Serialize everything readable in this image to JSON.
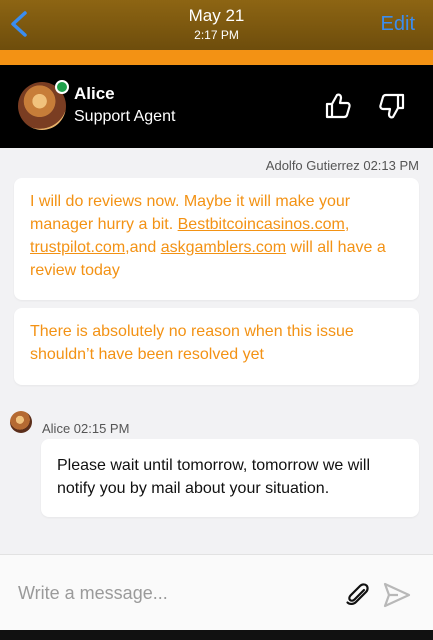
{
  "nav": {
    "date": "May 21",
    "time": "2:17 PM",
    "edit_label": "Edit"
  },
  "agent": {
    "name": "Alice",
    "role": "Support Agent",
    "status": "online"
  },
  "messages": [
    {
      "author": "Adolfo Gutierrez",
      "time": "02:13 PM",
      "meta": "Adolfo Gutierrez 02:13 PM",
      "parts": {
        "t1": "I will do reviews now. Maybe it will make your manager hurry a bit. ",
        "l1": "Bestbitcoincasinos.com",
        "t2": ", ",
        "l2": "trustpilot.com",
        "t3": ",and ",
        "l3": "askgamblers.com",
        "t4": " will all have a review today"
      }
    },
    {
      "author": "Adolfo Gutierrez",
      "text": "There is absolutely no reason when this issue shouldn’t have been resolved yet"
    },
    {
      "author": "Alice",
      "time": "02:15 PM",
      "meta": "Alice 02:15 PM",
      "text": "Please wait until tomorrow, tomorrow we will notify you by mail about your situation."
    }
  ],
  "composer": {
    "placeholder": "Write a message..."
  },
  "icons": {
    "back": "chevron-left-icon",
    "thumbs_up": "thumbs-up-icon",
    "thumbs_down": "thumbs-down-icon",
    "attach": "paperclip-icon",
    "send": "send-icon"
  },
  "colors": {
    "accent_orange": "#f39214",
    "ios_blue": "#3a8df0",
    "online_green": "#1ea04b"
  }
}
